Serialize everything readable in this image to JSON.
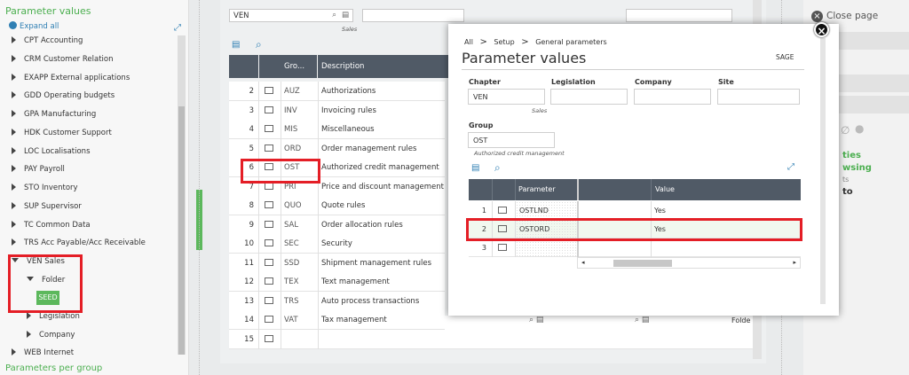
{
  "left_panel": {
    "title": "Parameter values",
    "expand_all": "Expand all",
    "items": [
      {
        "label": "CPT Accounting"
      },
      {
        "label": "CRM Customer Relation"
      },
      {
        "label": "EXAPP External applications"
      },
      {
        "label": "GDD Operating budgets"
      },
      {
        "label": "GPA Manufacturing"
      },
      {
        "label": "HDK Customer Support"
      },
      {
        "label": "LOC Localisations"
      },
      {
        "label": "PAY Payroll"
      },
      {
        "label": "STO Inventory"
      },
      {
        "label": "SUP Supervisor"
      },
      {
        "label": "TC Common Data"
      },
      {
        "label": "TRS Acc Payable/Acc Receivable"
      },
      {
        "label": "VEN Sales"
      },
      {
        "label": "Folder"
      },
      {
        "label": "SEED"
      },
      {
        "label": "Legislation"
      },
      {
        "label": "Company"
      },
      {
        "label": "WEB Internet"
      }
    ],
    "bottom_section": "Parameters per group"
  },
  "main": {
    "chapter_value": "VEN",
    "chapter_sub": "Sales",
    "headers": {
      "group": "Gro...",
      "description": "Description"
    },
    "rows": [
      {
        "num": "2",
        "group": "AUZ",
        "desc": "Authorizations"
      },
      {
        "num": "3",
        "group": "INV",
        "desc": "Invoicing rules"
      },
      {
        "num": "4",
        "group": "MIS",
        "desc": "Miscellaneous"
      },
      {
        "num": "5",
        "group": "ORD",
        "desc": "Order management rules"
      },
      {
        "num": "6",
        "group": "OST",
        "desc": "Authorized credit management"
      },
      {
        "num": "7",
        "group": "PRI",
        "desc": "Price and discount management"
      },
      {
        "num": "8",
        "group": "QUO",
        "desc": "Quote rules"
      },
      {
        "num": "9",
        "group": "SAL",
        "desc": "Order allocation rules"
      },
      {
        "num": "10",
        "group": "SEC",
        "desc": "Security"
      },
      {
        "num": "11",
        "group": "SSD",
        "desc": "Shipment management rules"
      },
      {
        "num": "12",
        "group": "TEX",
        "desc": "Text management"
      },
      {
        "num": "13",
        "group": "TRS",
        "desc": "Auto process transactions"
      },
      {
        "num": "14",
        "group": "VAT",
        "desc": "Tax management"
      },
      {
        "num": "15",
        "group": "",
        "desc": ""
      }
    ],
    "folder_label": "Folde"
  },
  "right_panel": {
    "close_page": "Close page",
    "link1": "ties",
    "link2": "wsing",
    "link3": "ts",
    "link4": "to"
  },
  "modal": {
    "breadcrumb": [
      "All",
      "Setup",
      "General parameters"
    ],
    "title": "Parameter values",
    "sage": "SAGE",
    "chapter_label": "Chapter",
    "chapter_value": "VEN",
    "chapter_sub": "Sales",
    "legislation_label": "Legislation",
    "company_label": "Company",
    "site_label": "Site",
    "group_label": "Group",
    "group_value": "OST",
    "group_sub": "Authorized credit management",
    "col_parameter": "Parameter",
    "col_value": "Value",
    "rows": [
      {
        "num": "1",
        "param": "OSTLND",
        "value": "Yes"
      },
      {
        "num": "2",
        "param": "OSTORD",
        "value": "Yes"
      },
      {
        "num": "3",
        "param": "",
        "value": ""
      }
    ]
  }
}
